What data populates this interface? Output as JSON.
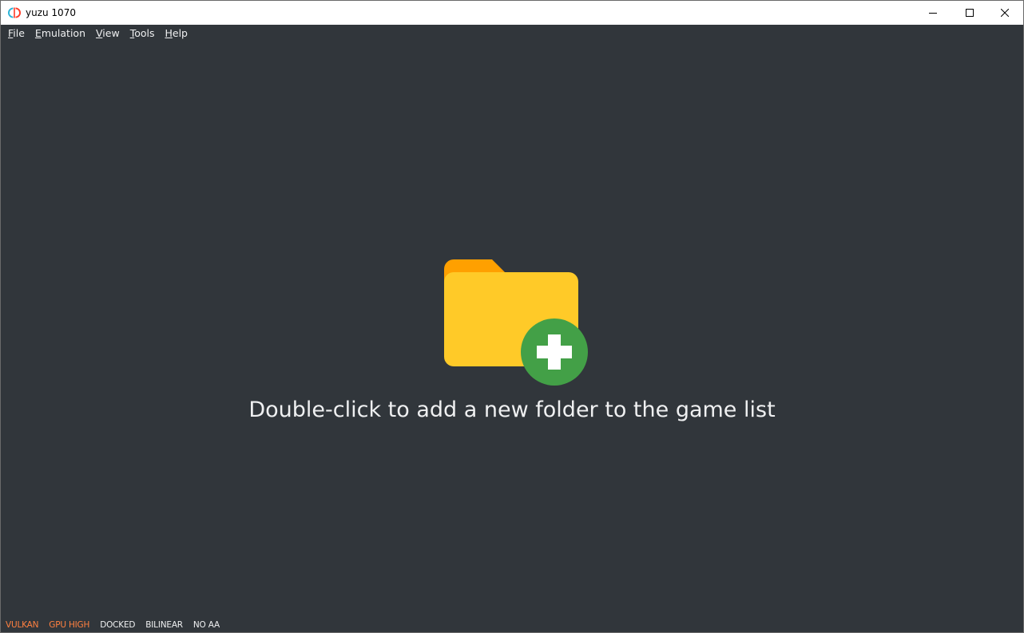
{
  "window": {
    "title": "yuzu 1070"
  },
  "menubar": {
    "items": [
      {
        "accel": "F",
        "rest": "ile"
      },
      {
        "accel": "E",
        "rest": "mulation"
      },
      {
        "accel": "V",
        "rest": "iew"
      },
      {
        "accel": "T",
        "rest": "ools"
      },
      {
        "accel": "H",
        "rest": "elp"
      }
    ]
  },
  "main": {
    "placeholder_text": "Double-click to add a new folder to the game list",
    "icon": "folder-add-icon"
  },
  "statusbar": {
    "items": [
      {
        "label": "VULKAN",
        "color": "#ff8040"
      },
      {
        "label": "GPU HIGH",
        "color": "#ff8040"
      },
      {
        "label": "DOCKED",
        "color": "#eff0f1"
      },
      {
        "label": "BILINEAR",
        "color": "#eff0f1"
      },
      {
        "label": "NO AA",
        "color": "#eff0f1"
      }
    ]
  },
  "colors": {
    "background": "#31363b",
    "folder_back": "#ffa000",
    "folder_front": "#ffca28",
    "plus_circle": "#43a047"
  }
}
